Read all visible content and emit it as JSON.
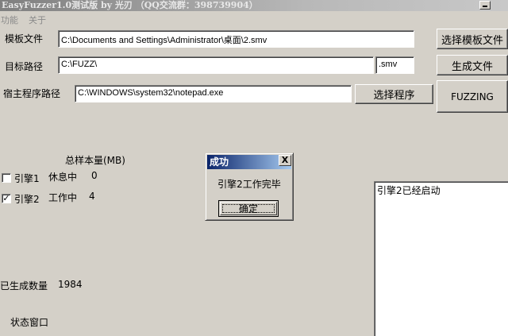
{
  "window": {
    "title": "EasyFuzzer1.0测试版  by 光刃  （QQ交流群：398739904）"
  },
  "menu": {
    "items": [
      "功能",
      "关于"
    ]
  },
  "form": {
    "template_label": "模板文件",
    "template_value": "C:\\Documents and Settings\\Administrator\\桌面\\2.smv",
    "target_label": "目标路径",
    "target_value": "C:\\FUZZ\\",
    "ext_value": ".smv",
    "host_label": "宿主程序路径",
    "host_value": "C:\\WINDOWS\\system32\\notepad.exe"
  },
  "buttons": {
    "select_template": "选择模板文件",
    "generate": "生成文件",
    "select_program": "选择程序",
    "fuzzing": "FUZZING"
  },
  "engines": {
    "header": "总样本量(MB)",
    "rows": [
      {
        "label": "引擎1",
        "checked": false,
        "status": "休息中",
        "count": "0"
      },
      {
        "label": "引擎2",
        "checked": true,
        "status": "工作中",
        "count": "4"
      }
    ]
  },
  "generated": {
    "label": "已生成数量",
    "value": "1984"
  },
  "status_window_label": "状态窗口",
  "log": {
    "lines": [
      "引擎2已经启动"
    ]
  },
  "dialog": {
    "title": "成功",
    "close": "X",
    "message": "引擎2工作完毕",
    "ok": "确定"
  },
  "colors": {
    "background": "#d4d0c8",
    "dialog_title_start": "#0a246a",
    "dialog_title_end": "#a6caf0"
  }
}
